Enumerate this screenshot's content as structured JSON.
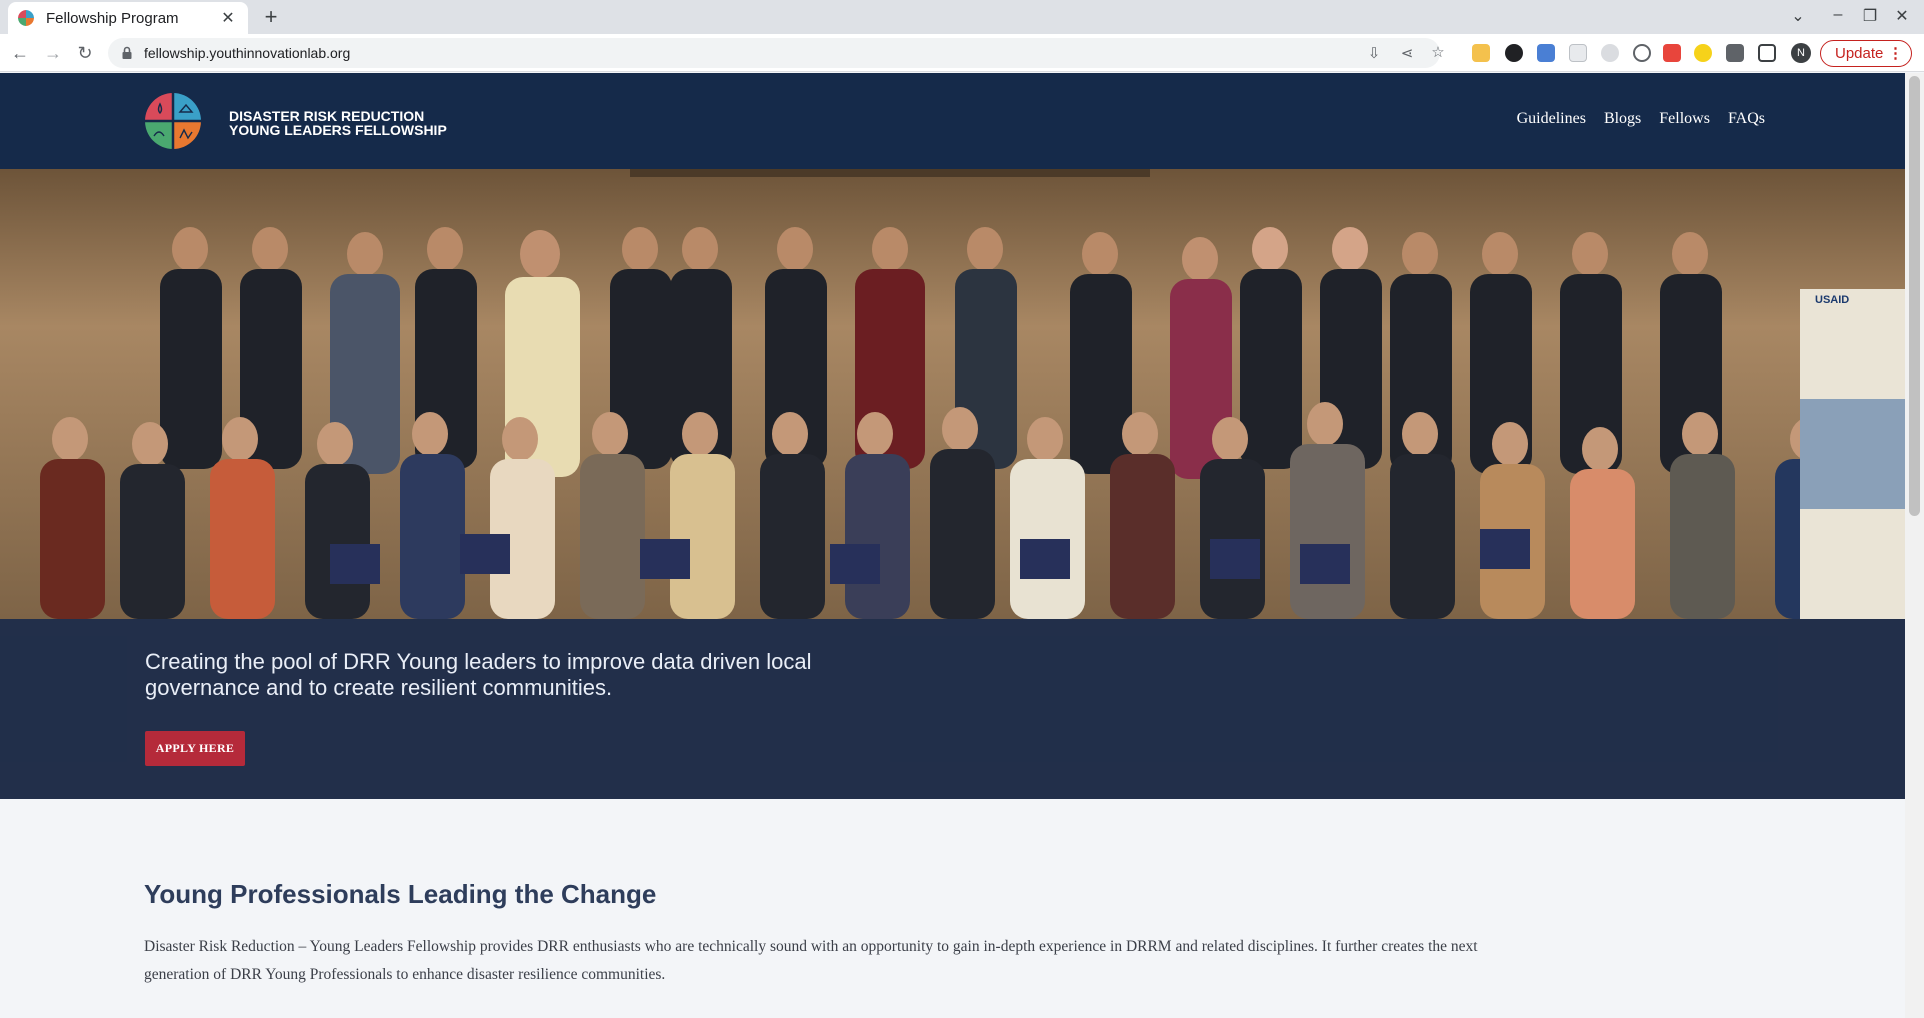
{
  "browser": {
    "tab_title": "Fellowship Program",
    "tab_close": "✕",
    "new_tab": "+",
    "url": "fellowship.youthinnovationlab.org",
    "update_label": "Update",
    "profile_initial": "N",
    "window_controls": {
      "dropdown": "⌄",
      "minimize": "–",
      "restore": "❐",
      "close": "✕"
    },
    "nav_icons": {
      "back": "←",
      "forward": "→",
      "reload": "↻"
    },
    "toolbar_icons": {
      "install": "⇩",
      "share": "⋖",
      "bookmark": "☆"
    }
  },
  "site": {
    "brand_line1": "DISASTER RISK REDUCTION",
    "brand_line2": "YOUNG LEADERS FELLOWSHIP",
    "nav": [
      "Guidelines",
      "Blogs",
      "Fellows",
      "FAQs"
    ]
  },
  "hero": {
    "tagline": "Creating the pool of DRR Young leaders to improve data driven local governance and to create resilient communities.",
    "cta_label": "APPLY HERE",
    "banner_text": "USAID"
  },
  "intro": {
    "title": "Young Professionals Leading the Change",
    "body": "Disaster Risk Reduction – Young Leaders Fellowship provides DRR enthusiasts who are technically sound with an opportunity to gain in-depth experience in DRRM and related disciplines. It further creates the next generation of DRR Young Professionals to enhance disaster resilience communities."
  },
  "colors": {
    "header_bg": "#152a4a",
    "cta_bg": "#b52a3a",
    "title_color": "#2e3d5b",
    "logo_quadrants": [
      "#d94a5a",
      "#3aa0c8",
      "#4aa870",
      "#e87830"
    ]
  }
}
